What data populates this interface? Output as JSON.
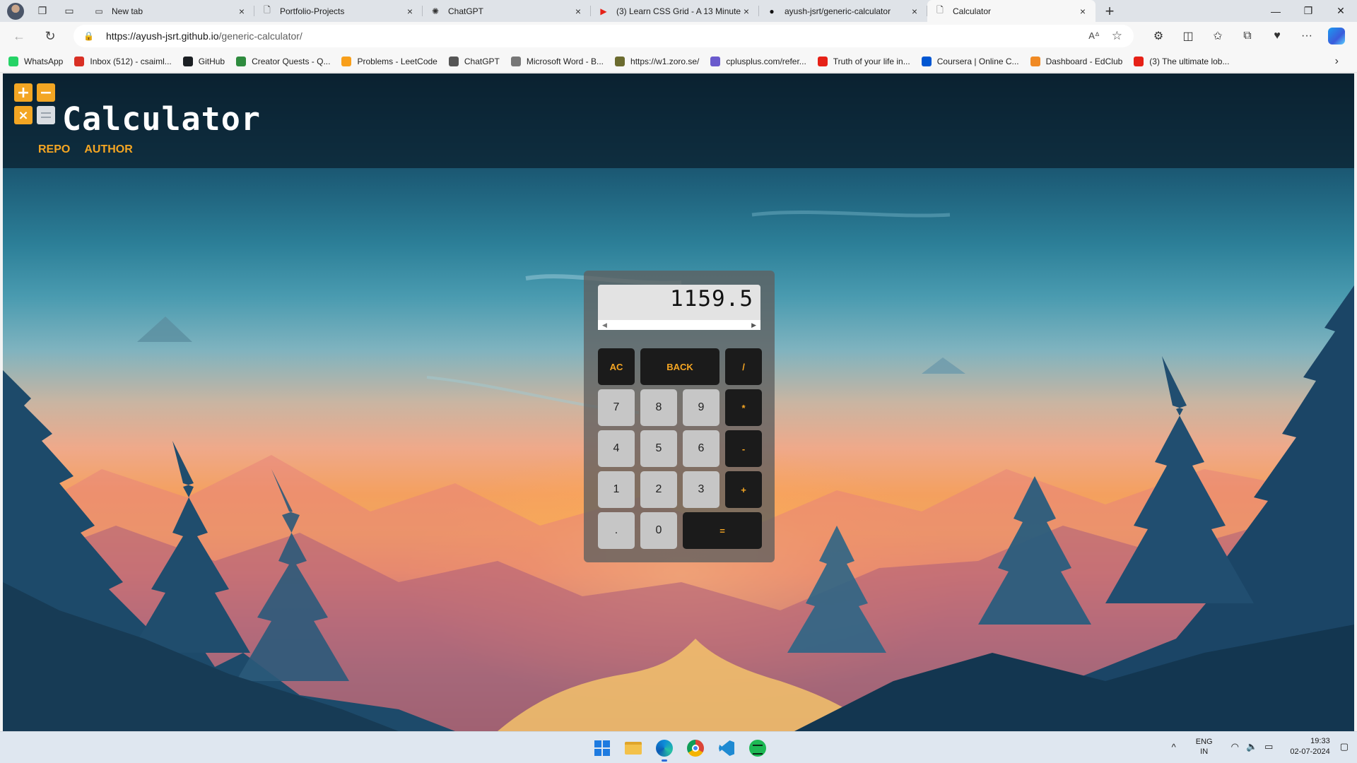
{
  "browser": {
    "tabs": [
      {
        "label": "New tab",
        "icon": "newtab-icon",
        "active": false
      },
      {
        "label": "Portfolio-Projects",
        "icon": "page-icon",
        "active": false
      },
      {
        "label": "ChatGPT",
        "icon": "chatgpt-icon",
        "active": false
      },
      {
        "label": "(3) Learn CSS Grid - A 13 Minute",
        "icon": "youtube-icon",
        "active": false
      },
      {
        "label": "ayush-jsrt/generic-calculator",
        "icon": "github-icon",
        "active": false
      },
      {
        "label": "Calculator",
        "icon": "page-icon",
        "active": true
      }
    ],
    "url_host": "https://ayush-jsrt.github.io",
    "url_path": "/generic-calculator/",
    "bookmarks": [
      {
        "label": "WhatsApp",
        "color": "#25d366"
      },
      {
        "label": "Inbox (512) - csaiml...",
        "color": "#d93025"
      },
      {
        "label": "GitHub",
        "color": "#1b1f23"
      },
      {
        "label": "Creator Quests - Q...",
        "color": "#2e8b3e"
      },
      {
        "label": "Problems - LeetCode",
        "color": "#f89f1b"
      },
      {
        "label": "ChatGPT",
        "color": "#555555"
      },
      {
        "label": "Microsoft Word - B...",
        "color": "#777777"
      },
      {
        "label": "https://w1.zoro.se/",
        "color": "#6b6b2f"
      },
      {
        "label": "cplusplus.com/refer...",
        "color": "#6a5acd"
      },
      {
        "label": "Truth of your life in...",
        "color": "#e62117"
      },
      {
        "label": "Coursera | Online C...",
        "color": "#0056d2"
      },
      {
        "label": "Dashboard - EdClub",
        "color": "#f08a24"
      },
      {
        "label": "(3) The ultimate lob...",
        "color": "#e62117"
      }
    ]
  },
  "site": {
    "title": "Calculator",
    "nav": [
      "REPO",
      "AUTHOR"
    ],
    "accent_color": "#f5a623"
  },
  "calculator": {
    "display_value": "1159.5",
    "keys": [
      {
        "label": "AC",
        "kind": "op"
      },
      {
        "label": "BACK",
        "kind": "op",
        "wide": true
      },
      {
        "label": "/",
        "kind": "op"
      },
      {
        "label": "7",
        "kind": "num"
      },
      {
        "label": "8",
        "kind": "num"
      },
      {
        "label": "9",
        "kind": "num"
      },
      {
        "label": "*",
        "kind": "op"
      },
      {
        "label": "4",
        "kind": "num"
      },
      {
        "label": "5",
        "kind": "num"
      },
      {
        "label": "6",
        "kind": "num"
      },
      {
        "label": "-",
        "kind": "op"
      },
      {
        "label": "1",
        "kind": "num"
      },
      {
        "label": "2",
        "kind": "num"
      },
      {
        "label": "3",
        "kind": "num"
      },
      {
        "label": "+",
        "kind": "op"
      },
      {
        "label": ".",
        "kind": "num"
      },
      {
        "label": "0",
        "kind": "num"
      },
      {
        "label": "=",
        "kind": "op",
        "wide": true
      }
    ]
  },
  "taskbar": {
    "apps": [
      "windows-start-icon",
      "file-explorer-icon",
      "edge-icon",
      "chrome-icon",
      "vscode-icon",
      "spotify-icon"
    ],
    "lang_line1": "ENG",
    "lang_line2": "IN",
    "time": "19:33",
    "date": "02-07-2024"
  }
}
